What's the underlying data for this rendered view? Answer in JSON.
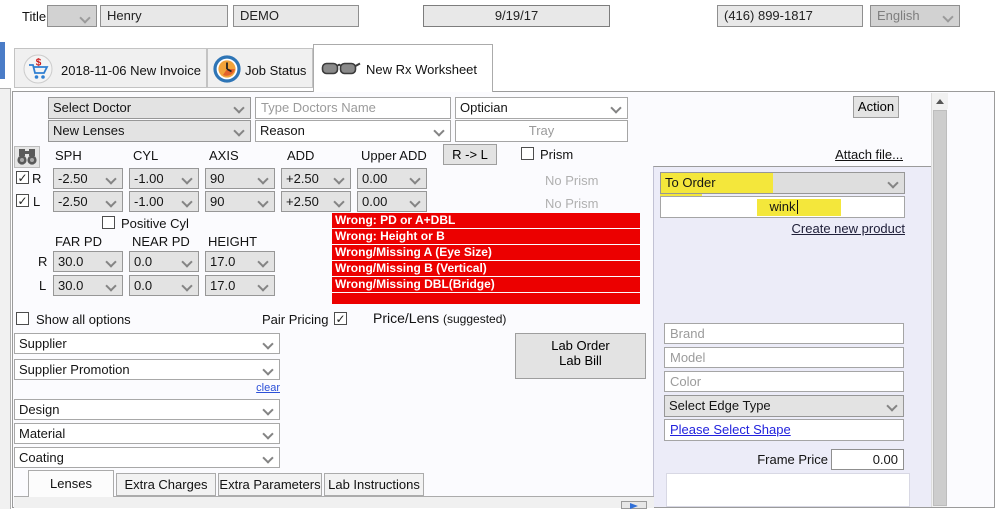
{
  "top_bar": {
    "title_label": "Title",
    "first_name": "Henry",
    "last_name": "DEMO",
    "date": "9/19/17",
    "phone": "(416) 899-1817",
    "language": "English"
  },
  "tabs": {
    "invoice": "2018-11-06 New Invoice",
    "job_status": "Job Status",
    "rx_worksheet": "New Rx Worksheet"
  },
  "doctor_row": {
    "select_doctor": "Select Doctor",
    "doctor_name_placeholder": "Type Doctors Name",
    "optician": "Optician",
    "lens_type": "New Lenses",
    "reason": "Reason",
    "tray_placeholder": "Tray"
  },
  "toolbar": {
    "action": "Action",
    "attach_file": "Attach file...",
    "r_to_l": "R -> L"
  },
  "rx": {
    "headers": {
      "sph": "SPH",
      "cyl": "CYL",
      "axis": "AXIS",
      "add": "ADD",
      "upper_add": "Upper ADD"
    },
    "prism_label": "Prism",
    "rows": [
      {
        "eye": "R",
        "sph": "-2.50",
        "cyl": "-1.00",
        "axis": "90",
        "add": "+2.50",
        "upper_add": "0.00",
        "prism": "No Prism"
      },
      {
        "eye": "L",
        "sph": "-2.50",
        "cyl": "-1.00",
        "axis": "90",
        "add": "+2.50",
        "upper_add": "0.00",
        "prism": "No Prism"
      }
    ],
    "positive_cyl_label": "Positive Cyl",
    "pd_headers": {
      "far": "FAR PD",
      "near": "NEAR PD",
      "height": "HEIGHT"
    },
    "pd_rows": [
      {
        "eye": "R",
        "far_pd": "30.0",
        "near_pd": "0.0",
        "height": "17.0"
      },
      {
        "eye": "L",
        "far_pd": "30.0",
        "near_pd": "0.0",
        "height": "17.0"
      }
    ]
  },
  "errors": [
    "Wrong: PD or A+DBL",
    "Wrong: Height or B",
    "Wrong/Missing A (Eye Size)",
    "Wrong/Missing B (Vertical)",
    "Wrong/Missing DBL(Bridge)"
  ],
  "pricing": {
    "show_all_options": "Show all options",
    "pair_pricing": "Pair Pricing",
    "price_lens": "Price/Lens",
    "price_lens_note": "(suggested)"
  },
  "lens_selects": {
    "supplier": "Supplier",
    "supplier_promotion": "Supplier Promotion",
    "clear": "clear",
    "design": "Design",
    "material": "Material",
    "coating": "Coating"
  },
  "lab_button": {
    "line1": "Lab Order",
    "line2": "Lab Bill"
  },
  "product_panel": {
    "status": "To Order",
    "search_value": "wink",
    "create_new_product": "Create new product",
    "brand_placeholder": "Brand",
    "model_placeholder": "Model",
    "color_placeholder": "Color",
    "edge_type": "Select Edge Type",
    "select_shape": "Please Select Shape",
    "frame_price_label": "Frame Price",
    "frame_price_value": "0.00"
  },
  "bottom_tabs": {
    "lenses": "Lenses",
    "extra_charges": "Extra Charges",
    "extra_parameters": "Extra Parameters",
    "lab_instructions": "Lab Instructions"
  },
  "checkbox_states": {
    "eye_r": true,
    "eye_l": true,
    "prism": false,
    "positive_cyl": false,
    "show_all_options": false,
    "pair_pricing": true
  },
  "colors": {
    "highlight_yellow": "#f4e73b",
    "error_red": "#ec0000",
    "link_blue": "#2b4fd8",
    "accent_blue": "#4a7cc7"
  }
}
